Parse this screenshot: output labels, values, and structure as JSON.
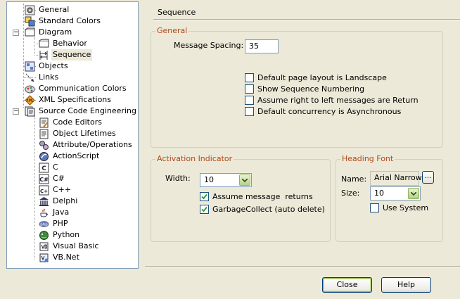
{
  "tree": {
    "items": [
      {
        "label": "General",
        "icon": "general-icon",
        "level": 1
      },
      {
        "label": "Standard Colors",
        "icon": "standard-colors-icon",
        "level": 1
      },
      {
        "label": "Diagram",
        "icon": "diagram-icon",
        "level": 0,
        "expander": "−"
      },
      {
        "label": "Behavior",
        "icon": "behavior-icon",
        "level": 2
      },
      {
        "label": "Sequence",
        "icon": "sequence-icon",
        "level": 2,
        "selected": true
      },
      {
        "label": "Objects",
        "icon": "objects-icon",
        "level": 1
      },
      {
        "label": "Links",
        "icon": "links-icon",
        "level": 1
      },
      {
        "label": "Communication Colors",
        "icon": "communication-colors-icon",
        "level": 1
      },
      {
        "label": "XML Specifications",
        "icon": "xml-icon",
        "level": 1
      },
      {
        "label": "Source Code Engineering",
        "icon": "source-code-icon",
        "level": 0,
        "expander": "−"
      },
      {
        "label": "Code Editors",
        "icon": "code-editors-icon",
        "level": 2
      },
      {
        "label": "Object Lifetimes",
        "icon": "object-lifetimes-icon",
        "level": 2
      },
      {
        "label": "Attribute/Operations",
        "icon": "attribute-operations-icon",
        "level": 2
      },
      {
        "label": "ActionScript",
        "icon": "actionscript-icon",
        "level": 2
      },
      {
        "label": "C",
        "icon": "c-icon",
        "level": 2
      },
      {
        "label": "C#",
        "icon": "csharp-icon",
        "level": 2
      },
      {
        "label": "C++",
        "icon": "cpp-icon",
        "level": 2
      },
      {
        "label": "Delphi",
        "icon": "delphi-icon",
        "level": 2
      },
      {
        "label": "Java",
        "icon": "java-icon",
        "level": 2
      },
      {
        "label": "PHP",
        "icon": "php-icon",
        "level": 2
      },
      {
        "label": "Python",
        "icon": "python-icon",
        "level": 2
      },
      {
        "label": "Visual Basic",
        "icon": "visual-basic-icon",
        "level": 2
      },
      {
        "label": "VB.Net",
        "icon": "vbnet-icon",
        "level": 2
      }
    ]
  },
  "page": {
    "title": "Sequence"
  },
  "general": {
    "title": "General",
    "message_spacing_label": "Message Spacing:",
    "message_spacing_value": "35",
    "options": [
      {
        "label": "Default page layout is Landscape",
        "checked": false
      },
      {
        "label": "Show Sequence Numbering",
        "checked": false
      },
      {
        "label": "Assume right to left messages are Return",
        "checked": false
      },
      {
        "label": "Default concurrency is Asynchronous",
        "checked": false
      }
    ]
  },
  "activation": {
    "title": "Activation Indicator",
    "width_label": "Width:",
    "width_value": "10",
    "options": [
      {
        "label": "Assume message  returns",
        "checked": true
      },
      {
        "label": "GarbageCollect (auto delete)",
        "checked": true
      }
    ]
  },
  "heading_font": {
    "title": "Heading Font",
    "name_label": "Name:",
    "name_value": "Arial Narrow",
    "browse_label": "...",
    "size_label": "Size:",
    "size_value": "10",
    "use_system_label": "Use System",
    "use_system_checked": false
  },
  "buttons": {
    "close": "Close",
    "help": "Help"
  },
  "colors": {
    "group_title": "#b04a1e",
    "tree_border": "#7f9db9",
    "dialog_bg": "#ece9d8",
    "check_mark": "#21a121"
  }
}
